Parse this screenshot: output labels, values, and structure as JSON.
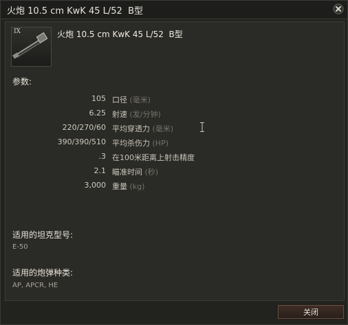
{
  "window": {
    "title": "火炮 10.5 cm KwK 45 L/52  B型"
  },
  "module": {
    "tier": "IX",
    "name": "火炮 10.5 cm KwK 45 L/52  B型",
    "icon": "gun-icon"
  },
  "params": {
    "label": "参数:",
    "rows": [
      {
        "value": "105",
        "name": "口径",
        "unit": "(毫米)"
      },
      {
        "value": "6.25",
        "name": "射速",
        "unit": "(发/分钟)"
      },
      {
        "value": "220/270/60",
        "name": "平均穿透力",
        "unit": "(毫米)"
      },
      {
        "value": "390/390/510",
        "name": "平均杀伤力",
        "unit": "(HP)"
      },
      {
        "value": ".3",
        "name": "在100米距离上射击精度",
        "unit": ""
      },
      {
        "value": "2.1",
        "name": "瞄准时间",
        "unit": "(秒)"
      },
      {
        "value": "3,000",
        "name": "重量",
        "unit": "(kg)"
      }
    ]
  },
  "compatible_tanks": {
    "label": "适用的坦克型号:",
    "value": "E-50"
  },
  "compatible_shells": {
    "label": "适用的炮弹种类:",
    "value": "AP, APCR, HE"
  },
  "buttons": {
    "close_label": "关闭"
  }
}
